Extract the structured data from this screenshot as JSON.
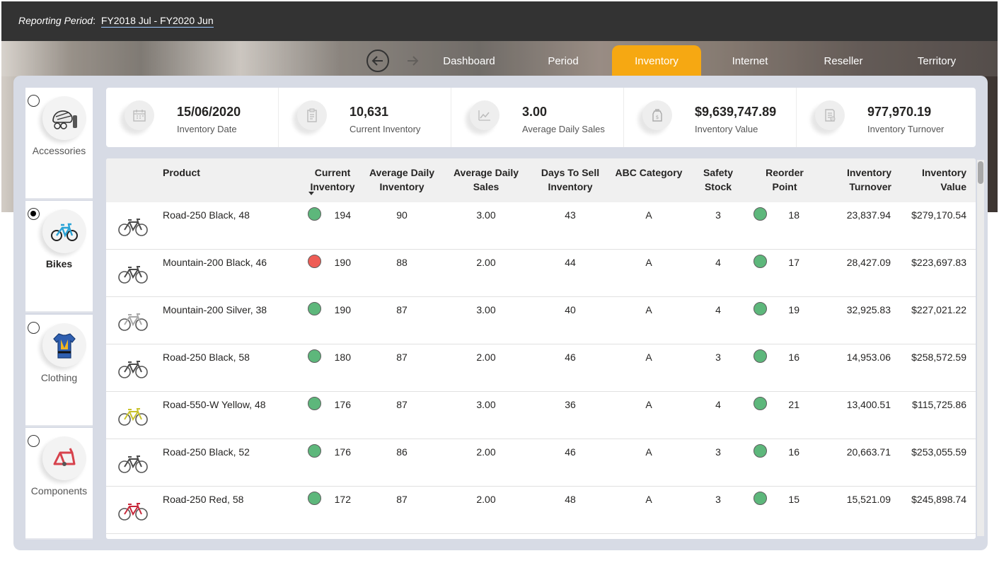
{
  "header": {
    "period_label": "Reporting Period",
    "period_value": "FY2018  Jul - FY2020  Jun"
  },
  "nav": {
    "tabs": [
      {
        "label": "Dashboard",
        "active": false
      },
      {
        "label": "Period",
        "active": false
      },
      {
        "label": "Inventory",
        "active": true
      },
      {
        "label": "Internet",
        "active": false
      },
      {
        "label": "Reseller",
        "active": false
      },
      {
        "label": "Territory",
        "active": false
      }
    ],
    "back_icon": "arrow-left-circle-icon",
    "forward_icon": "arrow-right-icon"
  },
  "categories": [
    {
      "label": "Accessories",
      "selected": false,
      "icon": "helmet-icon"
    },
    {
      "label": "Bikes",
      "selected": true,
      "icon": "bike-icon"
    },
    {
      "label": "Clothing",
      "selected": false,
      "icon": "jersey-icon"
    },
    {
      "label": "Components",
      "selected": false,
      "icon": "bike-frame-icon"
    }
  ],
  "kpis": [
    {
      "value": "15/06/2020",
      "label": "Inventory Date",
      "icon": "calendar-icon"
    },
    {
      "value": "10,631",
      "label": "Current Inventory",
      "icon": "clipboard-icon"
    },
    {
      "value": "3.00",
      "label": "Average Daily Sales",
      "icon": "line-chart-icon"
    },
    {
      "value": "$9,639,747.89",
      "label": "Inventory Value",
      "icon": "money-jar-icon"
    },
    {
      "value": "977,970.19",
      "label": "Inventory Turnover",
      "icon": "invoice-icon"
    }
  ],
  "table": {
    "columns": [
      {
        "line1": "Product",
        "line2": ""
      },
      {
        "line1": "Current",
        "line2": "Inventory"
      },
      {
        "line1": "Average Daily",
        "line2": "Inventory"
      },
      {
        "line1": "Average Daily",
        "line2": "Sales"
      },
      {
        "line1": "Days To Sell",
        "line2": "Inventory"
      },
      {
        "line1": "ABC Category",
        "line2": ""
      },
      {
        "line1": "Safety",
        "line2": "Stock"
      },
      {
        "line1": "Reorder",
        "line2": "Point"
      },
      {
        "line1": "Inventory",
        "line2": "Turnover"
      },
      {
        "line1": "Inventory",
        "line2": "Value"
      }
    ],
    "sorted_column": "Current Inventory",
    "sort_direction": "descending",
    "status_colors": {
      "ok": "#5db77b",
      "alert": "#ee5c55"
    },
    "rows": [
      {
        "product": "Road-250 Black, 48",
        "bike_color": "#4a4a4a",
        "inv_status": "ok",
        "current_inventory": "194",
        "avg_daily_inventory": "90",
        "avg_daily_sales": "3.00",
        "days_to_sell": "43",
        "abc": "A",
        "safety_stock": "3",
        "reorder_status": "ok",
        "reorder_point": "18",
        "turnover": "23,837.94",
        "value": "$279,170.54"
      },
      {
        "product": "Mountain-200 Black, 46",
        "bike_color": "#4a4a4a",
        "inv_status": "alert",
        "current_inventory": "190",
        "avg_daily_inventory": "88",
        "avg_daily_sales": "2.00",
        "days_to_sell": "44",
        "abc": "A",
        "safety_stock": "4",
        "reorder_status": "ok",
        "reorder_point": "17",
        "turnover": "28,427.09",
        "value": "$223,697.83"
      },
      {
        "product": "Mountain-200 Silver, 38",
        "bike_color": "#a9a9a9",
        "inv_status": "ok",
        "current_inventory": "190",
        "avg_daily_inventory": "87",
        "avg_daily_sales": "3.00",
        "days_to_sell": "40",
        "abc": "A",
        "safety_stock": "4",
        "reorder_status": "ok",
        "reorder_point": "19",
        "turnover": "32,925.83",
        "value": "$227,021.22"
      },
      {
        "product": "Road-250 Black, 58",
        "bike_color": "#4a4a4a",
        "inv_status": "ok",
        "current_inventory": "180",
        "avg_daily_inventory": "87",
        "avg_daily_sales": "2.00",
        "days_to_sell": "46",
        "abc": "A",
        "safety_stock": "3",
        "reorder_status": "ok",
        "reorder_point": "16",
        "turnover": "14,953.06",
        "value": "$258,572.59"
      },
      {
        "product": "Road-550-W Yellow, 48",
        "bike_color": "#c9c22b",
        "inv_status": "ok",
        "current_inventory": "176",
        "avg_daily_inventory": "87",
        "avg_daily_sales": "3.00",
        "days_to_sell": "36",
        "abc": "A",
        "safety_stock": "4",
        "reorder_status": "ok",
        "reorder_point": "21",
        "turnover": "13,400.51",
        "value": "$115,725.86"
      },
      {
        "product": "Road-250 Black, 52",
        "bike_color": "#4a4a4a",
        "inv_status": "ok",
        "current_inventory": "176",
        "avg_daily_inventory": "86",
        "avg_daily_sales": "2.00",
        "days_to_sell": "46",
        "abc": "A",
        "safety_stock": "3",
        "reorder_status": "ok",
        "reorder_point": "16",
        "turnover": "20,663.71",
        "value": "$253,055.59"
      },
      {
        "product": "Road-250 Red, 58",
        "bike_color": "#c8283a",
        "inv_status": "ok",
        "current_inventory": "172",
        "avg_daily_inventory": "87",
        "avg_daily_sales": "2.00",
        "days_to_sell": "48",
        "abc": "A",
        "safety_stock": "3",
        "reorder_status": "ok",
        "reorder_point": "15",
        "turnover": "15,521.09",
        "value": "$245,898.74"
      }
    ]
  }
}
